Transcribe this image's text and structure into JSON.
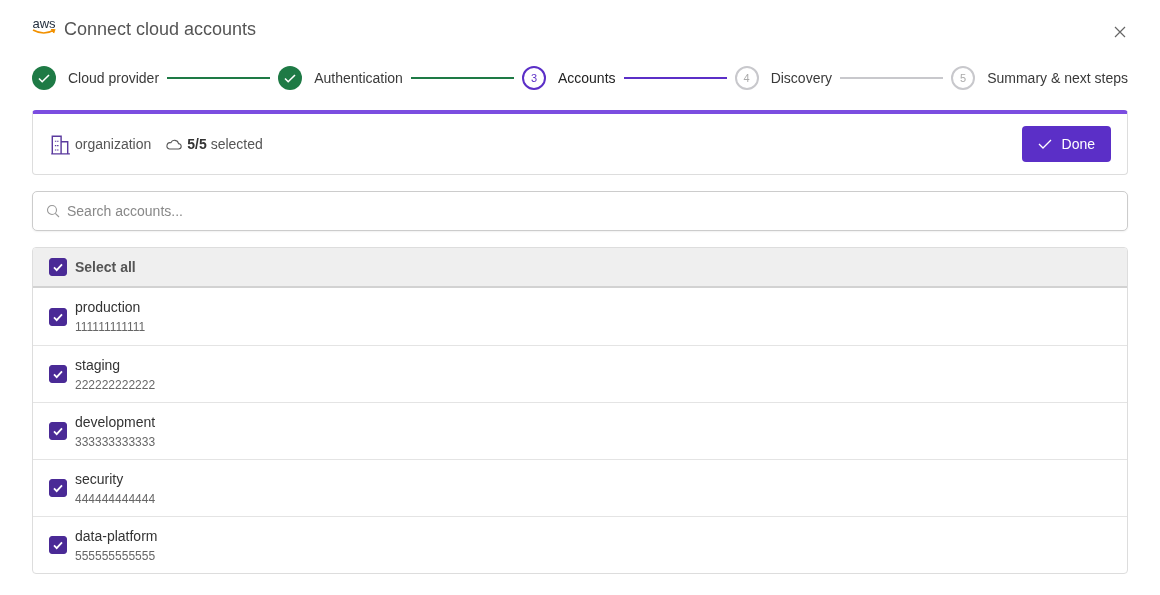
{
  "dialog": {
    "logo": "aws",
    "title": "Connect cloud accounts"
  },
  "steps": [
    {
      "label": "Cloud provider",
      "completed": true,
      "selected": false
    },
    {
      "label": "Authentication",
      "completed": true,
      "selected": false
    },
    {
      "label": "Accounts",
      "number": "3",
      "completed": false,
      "selected": true
    },
    {
      "label": "Discovery",
      "number": "4",
      "completed": false,
      "selected": false
    },
    {
      "label": "Summary & next steps",
      "number": "5",
      "completed": false,
      "selected": false
    }
  ],
  "summary": {
    "organization": "organization",
    "selected": "**5/5** selected",
    "button": "Done"
  },
  "search": {
    "placeholder": "Search accounts..."
  },
  "select_all": {
    "label": "Select all",
    "checked": true
  },
  "accounts": [
    {
      "name": "production",
      "id": "111111111111",
      "checked": true
    },
    {
      "name": "staging",
      "id": "222222222222",
      "checked": true
    },
    {
      "name": "development",
      "id": "333333333333",
      "checked": true
    },
    {
      "name": "security",
      "id": "444444444444",
      "checked": true
    },
    {
      "name": "data-platform",
      "id": "555555555555",
      "checked": true
    }
  ]
}
